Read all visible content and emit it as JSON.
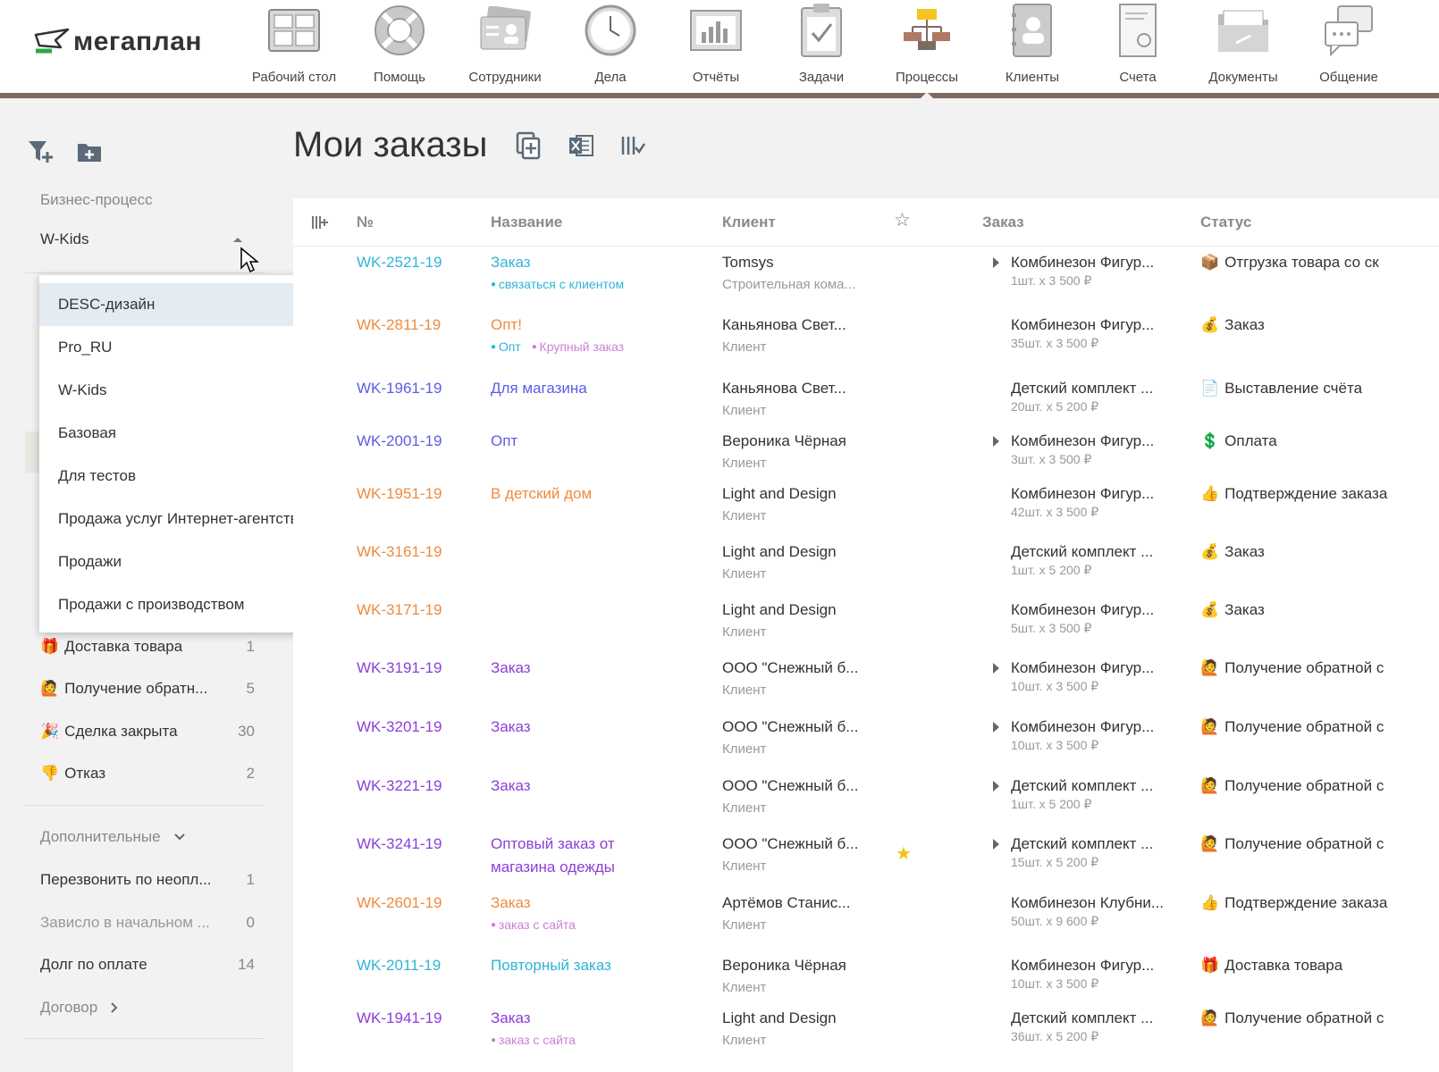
{
  "header": {
    "logo_text": "мегаплан",
    "nav": [
      {
        "label": "Рабочий стол",
        "icon": "desktop-icon"
      },
      {
        "label": "Помощь",
        "icon": "lifebuoy-icon"
      },
      {
        "label": "Сотрудники",
        "icon": "employees-icon"
      },
      {
        "label": "Дела",
        "icon": "clock-icon"
      },
      {
        "label": "Отчёты",
        "icon": "reports-icon"
      },
      {
        "label": "Задачи",
        "icon": "tasks-icon"
      },
      {
        "label": "Процессы",
        "icon": "processes-icon"
      },
      {
        "label": "Клиенты",
        "icon": "clients-icon"
      },
      {
        "label": "Счета",
        "icon": "invoices-icon"
      },
      {
        "label": "Документы",
        "icon": "documents-icon"
      },
      {
        "label": "Общение",
        "icon": "chat-icon"
      }
    ]
  },
  "sidebar": {
    "business_process_label": "Бизнес-процесс",
    "selected_process": "W-Kids",
    "dropdown_options": [
      "DESC-дизайн",
      "Pro_RU",
      "W-Kids",
      "Базовая",
      "Для тестов",
      "Продажа услуг Интернет-агентства",
      "Продажи",
      "Продажи с производством"
    ],
    "stages": [
      {
        "emoji": "🎁",
        "label": "Доставка товара",
        "count": "1"
      },
      {
        "emoji": "🙋",
        "label": "Получение обратн...",
        "count": "5"
      },
      {
        "emoji": "🎉",
        "label": "Сделка закрыта",
        "count": "30"
      },
      {
        "emoji": "👎",
        "label": "Отказ",
        "count": "2"
      }
    ],
    "extra_label": "Дополнительные",
    "extra_items": [
      {
        "label": "Перезвонить по неопл...",
        "count": "1"
      },
      {
        "label": "Зависло в начальном ...",
        "count": "0"
      },
      {
        "label": "Долг по оплате",
        "count": "14"
      }
    ],
    "contract_label": "Договор"
  },
  "main": {
    "title": "Мои заказы",
    "columns": {
      "num": "№",
      "name": "Название",
      "client": "Клиент",
      "order": "Заказ",
      "status": "Статус"
    }
  },
  "rows": [
    {
      "num": "WK-2521-19",
      "num_color": "#2fb4d6",
      "name": "Заказ",
      "name_color": "#2fb4d6",
      "tags": [
        {
          "text": "связаться с клиентом",
          "color": "#2fb4d6"
        }
      ],
      "client": "Tomsys",
      "client_sub": "Строительная кома...",
      "star": "",
      "expand": true,
      "order": "Комбинезон Фигур...",
      "order_sub": "1шт. x 3 500 ₽",
      "status_icon": "📦",
      "status": "Отгрузка товара со ск"
    },
    {
      "num": "WK-2811-19",
      "num_color": "#f08a3c",
      "name": "Опт!",
      "name_color": "#f08a3c",
      "tags": [
        {
          "text": "Опт",
          "color": "#2fb4d6"
        },
        {
          "text": "Крупный заказ",
          "color": "#cc7fd6"
        }
      ],
      "client": "Каньянова Свет...",
      "client_sub": "Клиент",
      "star": "",
      "expand": false,
      "order": "Комбинезон Фигур...",
      "order_sub": "35шт. x 3 500 ₽",
      "status_icon": "💰",
      "status": "Заказ"
    },
    {
      "num": "WK-1961-19",
      "num_color": "#5c5ce6",
      "name": "Для магазина",
      "name_color": "#5c5ce6",
      "tags": [],
      "client": "Каньянова Свет...",
      "client_sub": "Клиент",
      "star": "",
      "expand": false,
      "order": "Детский комплект ...",
      "order_sub": "20шт. x 5 200 ₽",
      "status_icon": "📄",
      "status": "Выставление счёта"
    },
    {
      "num": "WK-2001-19",
      "num_color": "#5c5ce6",
      "name": "Опт",
      "name_color": "#5c5ce6",
      "tags": [],
      "client": "Вероника Чёрная",
      "client_sub": "Клиент",
      "star": "",
      "expand": true,
      "order": "Комбинезон Фигур...",
      "order_sub": "3шт. x 3 500 ₽",
      "status_icon": "💲",
      "status": "Оплата"
    },
    {
      "num": "WK-1951-19",
      "num_color": "#f08a3c",
      "name": "В детский дом",
      "name_color": "#f08a3c",
      "tags": [],
      "client": "Light and Design",
      "client_sub": "Клиент",
      "star": "",
      "expand": false,
      "order": "Комбинезон Фигур...",
      "order_sub": "42шт. x 3 500 ₽",
      "status_icon": "👍",
      "status": "Подтверждение заказа"
    },
    {
      "num": "WK-3161-19",
      "num_color": "#f08a3c",
      "name": "",
      "name_color": "#f08a3c",
      "tags": [],
      "client": "Light and Design",
      "client_sub": "Клиент",
      "star": "",
      "expand": false,
      "order": "Детский комплект ...",
      "order_sub": "1шт. x 5 200 ₽",
      "status_icon": "💰",
      "status": "Заказ"
    },
    {
      "num": "WK-3171-19",
      "num_color": "#f08a3c",
      "name": "",
      "name_color": "#f08a3c",
      "tags": [],
      "client": "Light and Design",
      "client_sub": "Клиент",
      "star": "",
      "expand": false,
      "order": "Комбинезон Фигур...",
      "order_sub": "5шт. x 3 500 ₽",
      "status_icon": "💰",
      "status": "Заказ"
    },
    {
      "num": "WK-3191-19",
      "num_color": "#8b3fd9",
      "name": "Заказ",
      "name_color": "#8b3fd9",
      "tags": [],
      "client": "ООО \"Снежный б...",
      "client_sub": "Клиент",
      "star": "",
      "expand": true,
      "order": "Комбинезон Фигур...",
      "order_sub": "10шт. x 3 500 ₽",
      "status_icon": "🙋",
      "status": "Получение обратной с"
    },
    {
      "num": "WK-3201-19",
      "num_color": "#8b3fd9",
      "name": "Заказ",
      "name_color": "#8b3fd9",
      "tags": [],
      "client": "ООО \"Снежный б...",
      "client_sub": "Клиент",
      "star": "",
      "expand": true,
      "order": "Комбинезон Фигур...",
      "order_sub": "10шт. x 3 500 ₽",
      "status_icon": "🙋",
      "status": "Получение обратной с"
    },
    {
      "num": "WK-3221-19",
      "num_color": "#8b3fd9",
      "name": "Заказ",
      "name_color": "#8b3fd9",
      "tags": [],
      "client": "ООО \"Снежный б...",
      "client_sub": "Клиент",
      "star": "",
      "expand": true,
      "order": "Детский комплект ...",
      "order_sub": "1шт. x 5 200 ₽",
      "status_icon": "🙋",
      "status": "Получение обратной с"
    },
    {
      "num": "WK-3241-19",
      "num_color": "#8b3fd9",
      "name": "Оптовый заказ от",
      "name2": "магазина одежды",
      "name_color": "#8b3fd9",
      "tags": [],
      "client": "ООО \"Снежный б...",
      "client_sub": "Клиент",
      "star": "★",
      "expand": true,
      "order": "Детский комплект ...",
      "order_sub": "15шт. x 5 200 ₽",
      "status_icon": "🙋",
      "status": "Получение обратной с"
    },
    {
      "num": "WK-2601-19",
      "num_color": "#f08a3c",
      "name": "Заказ",
      "name_color": "#f08a3c",
      "tags": [
        {
          "text": "заказ с сайта",
          "color": "#cc7fd6"
        }
      ],
      "client": "Артёмов Станис...",
      "client_sub": "Клиент",
      "star": "",
      "expand": false,
      "order": "Комбинезон Клубни...",
      "order_sub": "50шт. x 9 600 ₽",
      "status_icon": "👍",
      "status": "Подтверждение заказа"
    },
    {
      "num": "WK-2011-19",
      "num_color": "#2fb4d6",
      "name": "Повторный заказ",
      "name_color": "#2fb4d6",
      "tags": [],
      "client": "Вероника Чёрная",
      "client_sub": "Клиент",
      "star": "",
      "expand": false,
      "order": "Комбинезон Фигур...",
      "order_sub": "10шт. x 3 500 ₽",
      "status_icon": "🎁",
      "status": "Доставка товара"
    },
    {
      "num": "WK-1941-19",
      "num_color": "#8b3fd9",
      "name": "Заказ",
      "name_color": "#8b3fd9",
      "tags": [
        {
          "text": "заказ с сайта",
          "color": "#cc7fd6"
        }
      ],
      "client": "Light and Design",
      "client_sub": "Клиент",
      "star": "",
      "expand": false,
      "order": "Детский комплект ...",
      "order_sub": "36шт. x 5 200 ₽",
      "status_icon": "🙋",
      "status": "Получение обратной с"
    }
  ]
}
